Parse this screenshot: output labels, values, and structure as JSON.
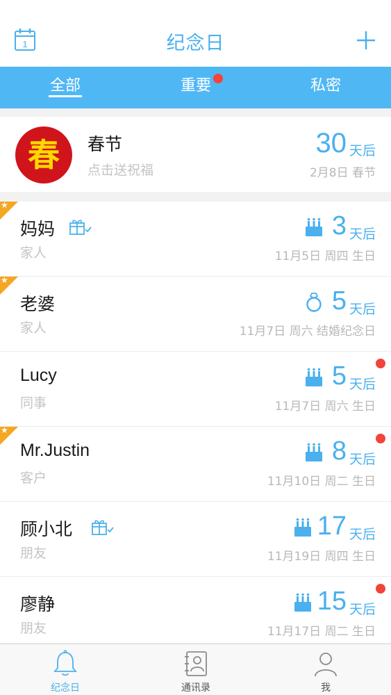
{
  "header": {
    "title": "纪念日",
    "calendar_day": "1"
  },
  "tabs": {
    "all": "全部",
    "important": "重要",
    "private": "私密"
  },
  "hero": {
    "avatar_text": "春",
    "name": "春节",
    "sub": "点击送祝福",
    "count": "30",
    "unit": "天后",
    "date": "2月8日 春节"
  },
  "rows": [
    {
      "name": "妈妈",
      "group": "家人",
      "count": "3",
      "unit": "天后",
      "date": "11月5日 周四 生日"
    },
    {
      "name": "老婆",
      "group": "家人",
      "count": "5",
      "unit": "天后",
      "date": "11月7日 周六 结婚纪念日"
    },
    {
      "name": "Lucy",
      "group": "同事",
      "count": "5",
      "unit": "天后",
      "date": "11月7日 周六 生日"
    },
    {
      "name": "Mr.Justin",
      "group": "客户",
      "count": "8",
      "unit": "天后",
      "date": "11月10日 周二 生日"
    },
    {
      "name": "顾小北",
      "group": "朋友",
      "count": "17",
      "unit": "天后",
      "date": "11月19日 周四 生日"
    },
    {
      "name": "廖静",
      "group": "朋友",
      "count": "15",
      "unit": "天后",
      "date": "11月17日 周二 生日"
    }
  ],
  "bottom_nav": {
    "anniversary": "纪念日",
    "contacts": "通讯录",
    "me": "我"
  },
  "colors": {
    "accent": "#4ab0ee",
    "tab_bar": "#50b7f5",
    "alert": "#f2443b",
    "star": "#f5a623"
  }
}
